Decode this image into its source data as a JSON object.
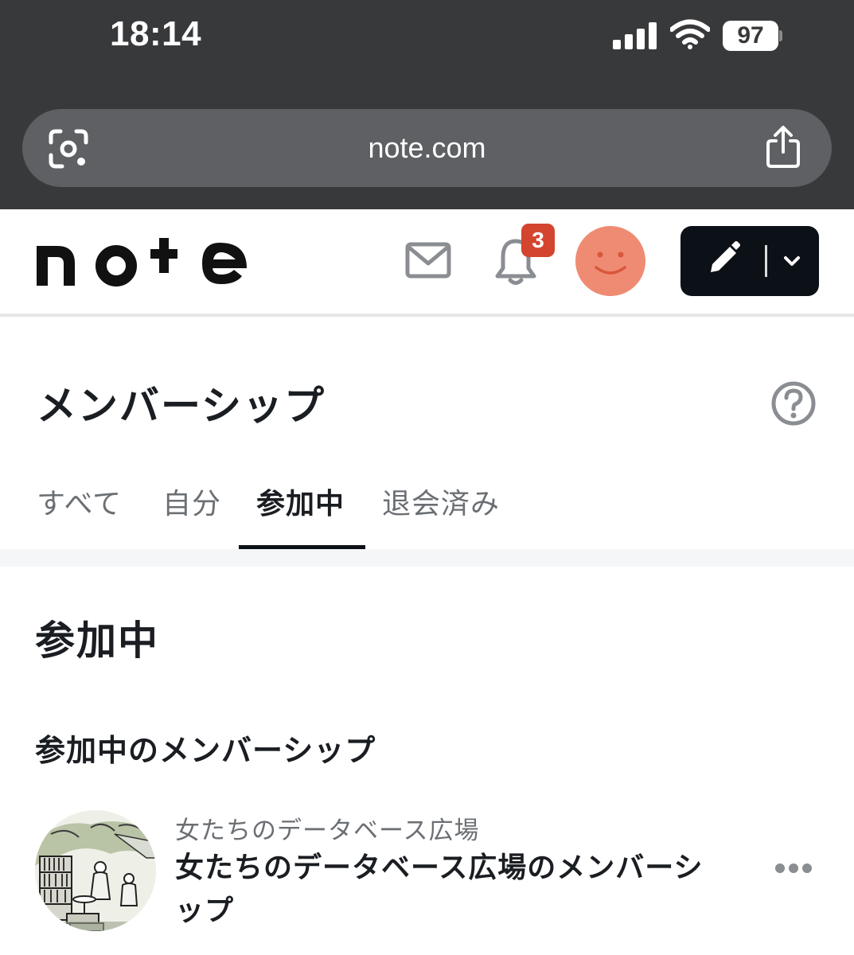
{
  "status_bar": {
    "time": "18:14",
    "battery": "97"
  },
  "browser": {
    "url": "note.com"
  },
  "header": {
    "logo_text": "note",
    "notification_count": "3"
  },
  "page": {
    "title": "メンバーシップ",
    "tabs": [
      {
        "label": "すべて",
        "active": false
      },
      {
        "label": "自分",
        "active": false
      },
      {
        "label": "参加中",
        "active": true
      },
      {
        "label": "退会済み",
        "active": false
      }
    ]
  },
  "content": {
    "section_heading": "参加中",
    "sub_heading": "参加中のメンバーシップ",
    "memberships": [
      {
        "creator": "女たちのデータベース広場",
        "plan": "女たちのデータベース広場のメンバーシップ"
      }
    ]
  },
  "colors": {
    "chrome_bg": "#38393b",
    "urlbar_bg": "#5e6064",
    "badge_red": "#d3452f",
    "avatar_salmon": "#ef8b72",
    "post_button_bg": "#0c1117",
    "tab_active_underline": "#0c1117"
  },
  "icons": {
    "lens": "google-lens-icon",
    "share": "share-icon",
    "mail": "mail-icon",
    "bell": "bell-icon",
    "avatar": "smiley-avatar-icon",
    "pencil": "pencil-icon",
    "chevron": "chevron-down-icon",
    "help": "question-circle-icon",
    "more": "more-horizontal-icon"
  }
}
